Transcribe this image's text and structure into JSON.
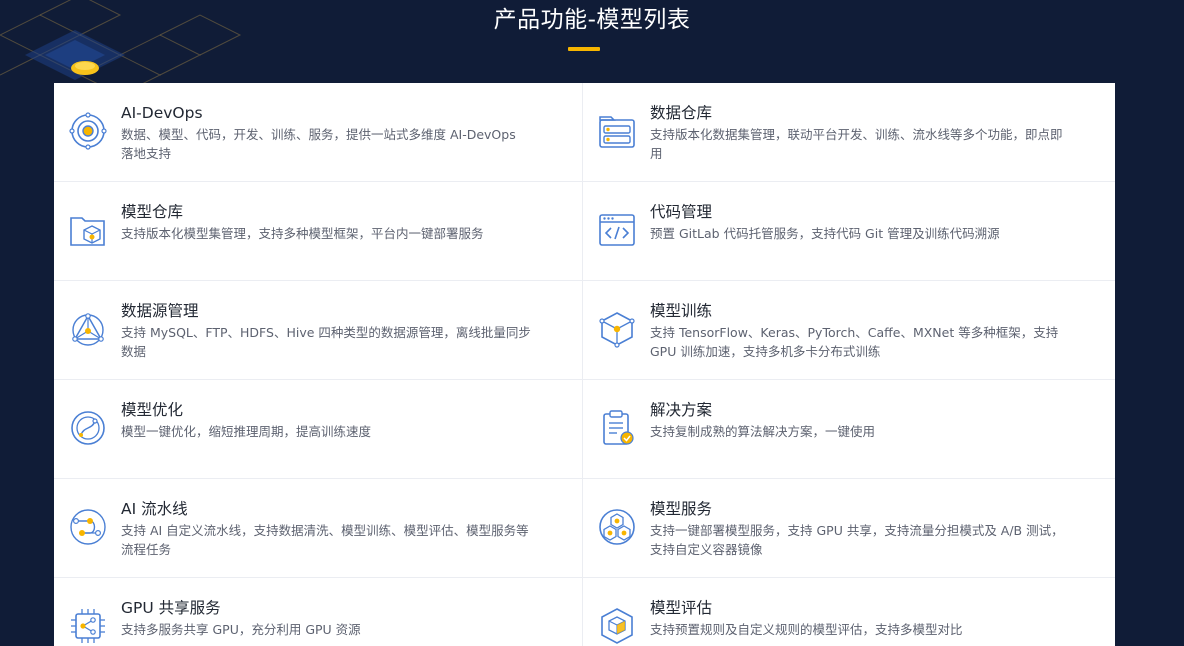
{
  "page": {
    "title": "产品功能-模型列表",
    "accent_color": "#f7b500",
    "background_color": "#101c37",
    "icon_color": "#4a7fd4"
  },
  "features": [
    {
      "name": "AI-DevOps",
      "desc": "数据、模型、代码，开发、训练、服务，提供一站式多维度 AI-DevOps 落地支持",
      "icon": "target-icon"
    },
    {
      "name": "数据仓库",
      "desc": "支持版本化数据集管理，联动平台开发、训练、流水线等多个功能，即点即用",
      "icon": "database-icon"
    },
    {
      "name": "模型仓库",
      "desc": "支持版本化模型集管理，支持多种模型框架，平台内一键部署服务",
      "icon": "folder-cube-icon"
    },
    {
      "name": "代码管理",
      "desc": "预置 GitLab 代码托管服务，支持代码 Git 管理及训练代码溯源",
      "icon": "code-window-icon"
    },
    {
      "name": "数据源管理",
      "desc": "支持 MySQL、FTP、HDFS、Hive 四种类型的数据源管理，离线批量同步数据",
      "icon": "triangle-network-icon"
    },
    {
      "name": "模型训练",
      "desc": "支持 TensorFlow、Keras、PyTorch、Caffe、MXNet 等多种框架，支持 GPU 训练加速，支持多机多卡分布式训练",
      "icon": "cube-network-icon"
    },
    {
      "name": "模型优化",
      "desc": "模型一键优化，缩短推理周期，提高训练速度",
      "icon": "optimize-icon"
    },
    {
      "name": "解决方案",
      "desc": "支持复制成熟的算法解决方案，一键使用",
      "icon": "clipboard-check-icon"
    },
    {
      "name": "AI 流水线",
      "desc": "支持 AI 自定义流水线，支持数据清洗、模型训练、模型评估、模型服务等流程任务",
      "icon": "pipeline-icon"
    },
    {
      "name": "模型服务",
      "desc": "支持一键部署模型服务，支持 GPU 共享，支持流量分担模式及 A/B 测试，支持自定义容器镜像",
      "icon": "hexagon-service-icon"
    },
    {
      "name": "GPU 共享服务",
      "desc": "支持多服务共享 GPU，充分利用 GPU 资源",
      "icon": "chip-share-icon"
    },
    {
      "name": "模型评估",
      "desc": "支持预置规则及自定义规则的模型评估，支持多模型对比",
      "icon": "cube-evaluate-icon"
    }
  ]
}
